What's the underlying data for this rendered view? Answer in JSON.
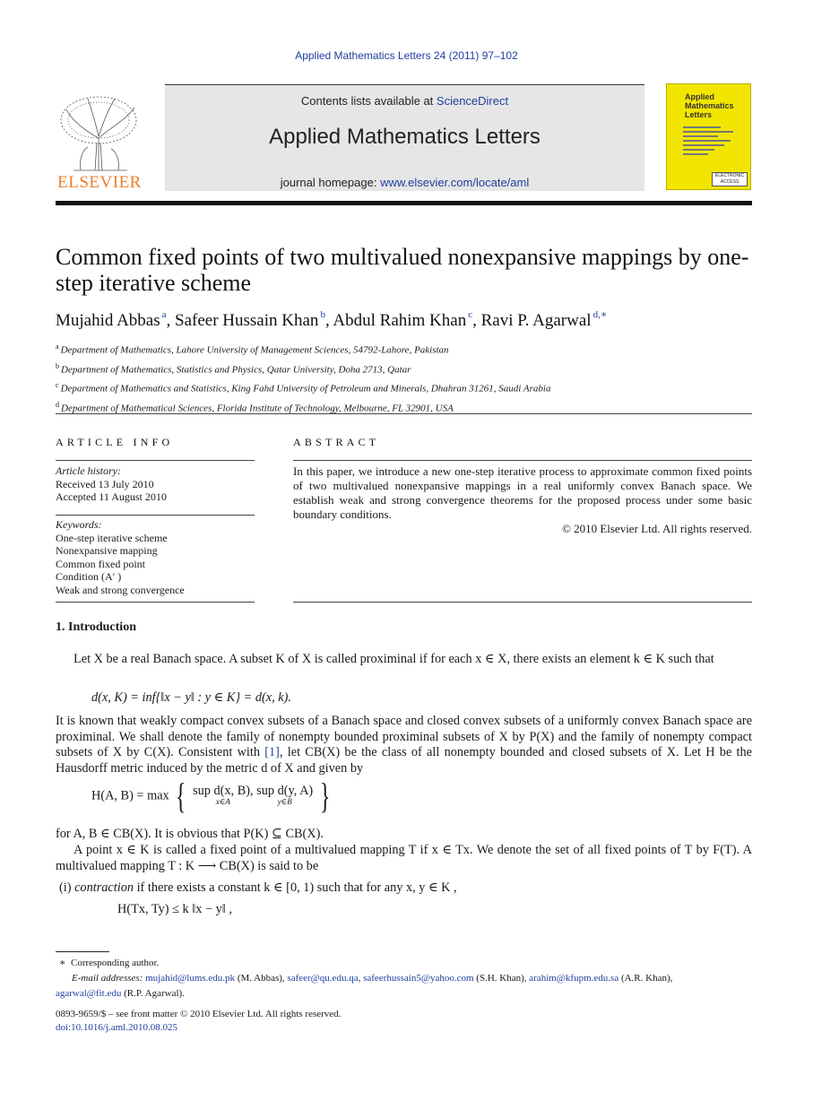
{
  "citation": "Applied Mathematics Letters 24 (2011) 97–102",
  "publisher": {
    "name": "ELSEVIER",
    "logo": "elsevier-tree-logo"
  },
  "header": {
    "contents_prefix": "Contents lists available at ",
    "contents_link": "ScienceDirect",
    "journal_name": "Applied Mathematics Letters",
    "homepage_prefix": "journal homepage: ",
    "homepage_link": "www.elsevier.com/locate/aml"
  },
  "cover": {
    "title_lines": [
      "Applied",
      "Mathematics",
      "Letters"
    ],
    "badge": "ELECTRONIC ACCESS"
  },
  "article": {
    "title": "Common fixed points of two multivalued nonexpansive mappings by one-step iterative scheme",
    "authors": [
      {
        "name": "Mujahid Abbas",
        "sup": "a"
      },
      {
        "name": "Safeer Hussain Khan",
        "sup": "b"
      },
      {
        "name": "Abdul Rahim Khan",
        "sup": "c"
      },
      {
        "name": "Ravi P. Agarwal",
        "sup": "d,∗"
      }
    ],
    "affiliations": [
      {
        "sup": "a",
        "text": "Department of Mathematics, Lahore University of Management Sciences, 54792-Lahore, Pakistan"
      },
      {
        "sup": "b",
        "text": "Department of Mathematics, Statistics and Physics, Qatar University, Doha 2713, Qatar"
      },
      {
        "sup": "c",
        "text": "Department of Mathematics and Statistics, King Fahd University of Petroleum and Minerals, Dhahran 31261, Saudi Arabia"
      },
      {
        "sup": "d",
        "text": "Department of Mathematical Sciences, Florida Institute of Technology, Melbourne, FL 32901, USA"
      }
    ]
  },
  "article_info": {
    "heading": "ARTICLE INFO",
    "history_label": "Article history:",
    "received": "Received 13 July 2010",
    "accepted": "Accepted 11 August 2010",
    "keywords_label": "Keywords:",
    "keywords": [
      "One-step iterative scheme",
      "Nonexpansive mapping",
      "Common fixed point",
      "Condition (A′ )",
      "Weak and strong convergence"
    ]
  },
  "abstract": {
    "heading": "ABSTRACT",
    "text": "In this paper, we introduce a new one-step iterative process to approximate common fixed points of two multivalued nonexpansive mappings in a real uniformly convex Banach space. We establish weak and strong convergence theorems for the proposed process under some basic boundary conditions.",
    "copyright": "© 2010 Elsevier Ltd. All rights reserved."
  },
  "body": {
    "section_heading": "1.  Introduction",
    "p1": "Let X be a real Banach space. A subset K of X is called proximinal if for each x ∈ X, there exists an element k ∈ K such that",
    "eq1": "d(x, K) = inf{‖x − y‖ : y ∈ K} = d(x, k).",
    "p2_a": "It is known that weakly compact convex subsets of a Banach space and closed convex subsets of a uniformly convex Banach space are proximinal. We shall denote the family of nonempty bounded proximinal subsets of X by P(X) and the family of nonempty compact subsets of X by C(X). Consistent with ",
    "p2_ref": "[1]",
    "p2_b": ", let CB(X) be the class of all nonempty bounded and closed subsets of X. Let H be the Hausdorff metric induced by the metric d of X and given by",
    "eq2_lhs": "H(A, B) = max",
    "eq2_sup1": "sup d(x, B),",
    "eq2_sub1": "x∈A",
    "eq2_sup2": "sup d(y, A)",
    "eq2_sub2": "y∈B",
    "p3": "for A, B ∈ CB(X). It is obvious that P(K) ⊆ CB(X).",
    "p4": "A point x ∈ K is called a fixed point of a multivalued mapping T if x ∈ Tx. We denote the set of all fixed points of T by F(T). A multivalued mapping T : K ⟶ CB(X) is said to be",
    "item1_num": "(i)",
    "item1_term": "contraction",
    "item1_text": " if there exists a constant k ∈ [0, 1) such that for any x, y ∈ K ,",
    "eq3": "H(Tx, Ty) ≤ k ‖x − y‖ ,"
  },
  "footnotes": {
    "star": "∗",
    "corresponding": "Corresponding author.",
    "email_label": "E-mail addresses:",
    "emails": [
      {
        "addr": "mujahid@lums.edu.pk",
        "who": "(M. Abbas),"
      },
      {
        "addr": "safeer@qu.edu.qa",
        "who": ","
      },
      {
        "addr": "safeerhussain5@yahoo.com",
        "who": "(S.H. Khan),"
      },
      {
        "addr": "arahim@kfupm.edu.sa",
        "who": "(A.R. Khan),"
      },
      {
        "addr": "agarwal@fit.edu",
        "who": "(R.P. Agarwal)."
      }
    ],
    "issn": "0893-9659/$ – see front matter © 2010 Elsevier Ltd. All rights reserved.",
    "doi": "doi:10.1016/j.aml.2010.08.025"
  }
}
